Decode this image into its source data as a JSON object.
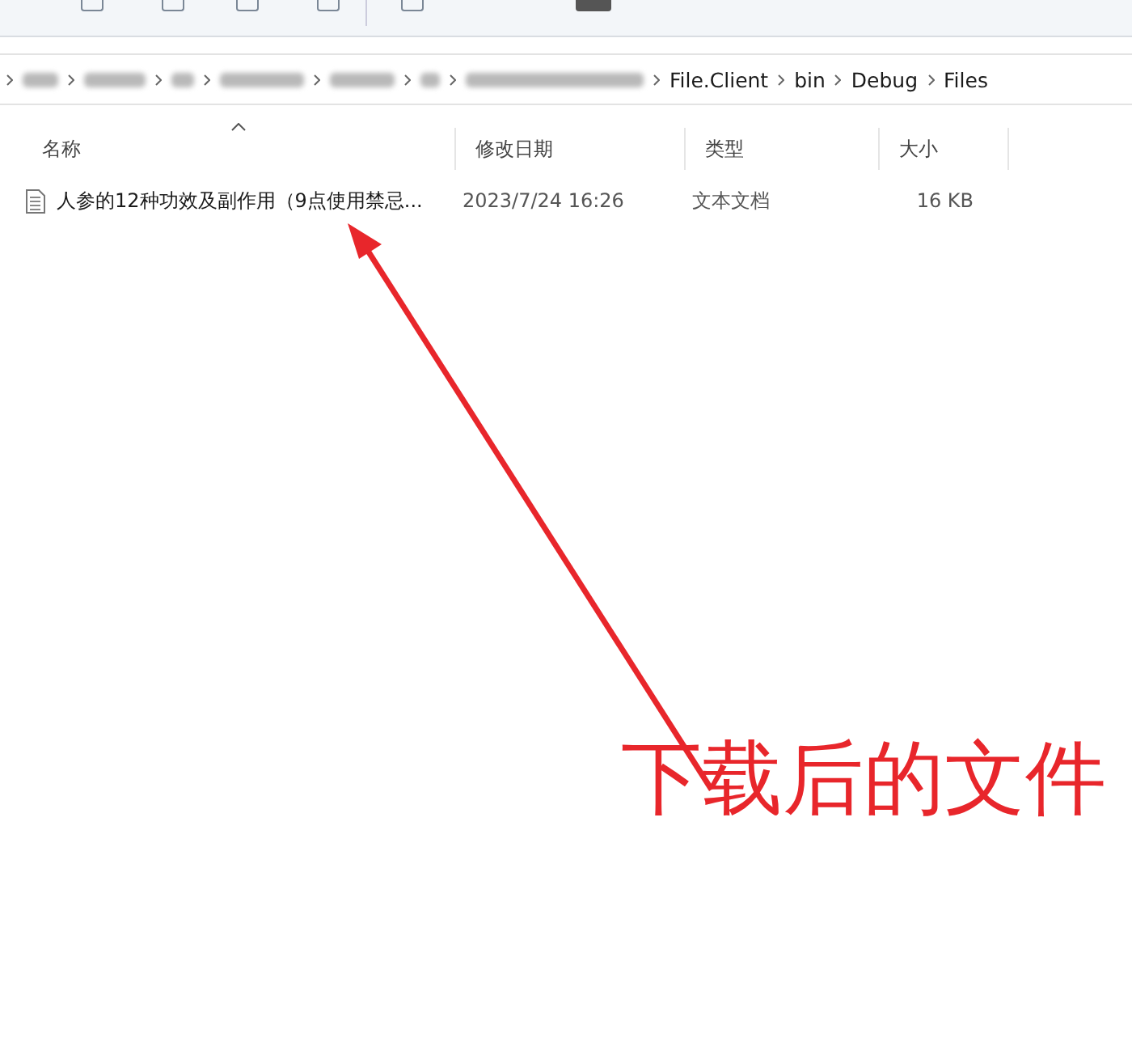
{
  "breadcrumb": {
    "items": [
      "File.Client",
      "bin",
      "Debug",
      "Files"
    ]
  },
  "columns": [
    {
      "label": "名称",
      "sorted": true
    },
    {
      "label": "修改日期",
      "sorted": false
    },
    {
      "label": "类型",
      "sorted": false
    },
    {
      "label": "大小",
      "sorted": false
    }
  ],
  "rows": [
    {
      "name": "人参的12种功效及副作用（9点使用禁忌...",
      "date": "2023/7/24 16:26",
      "type": "文本文档",
      "size": "16 KB"
    }
  ],
  "annotation": {
    "text": "下载后的文件"
  }
}
